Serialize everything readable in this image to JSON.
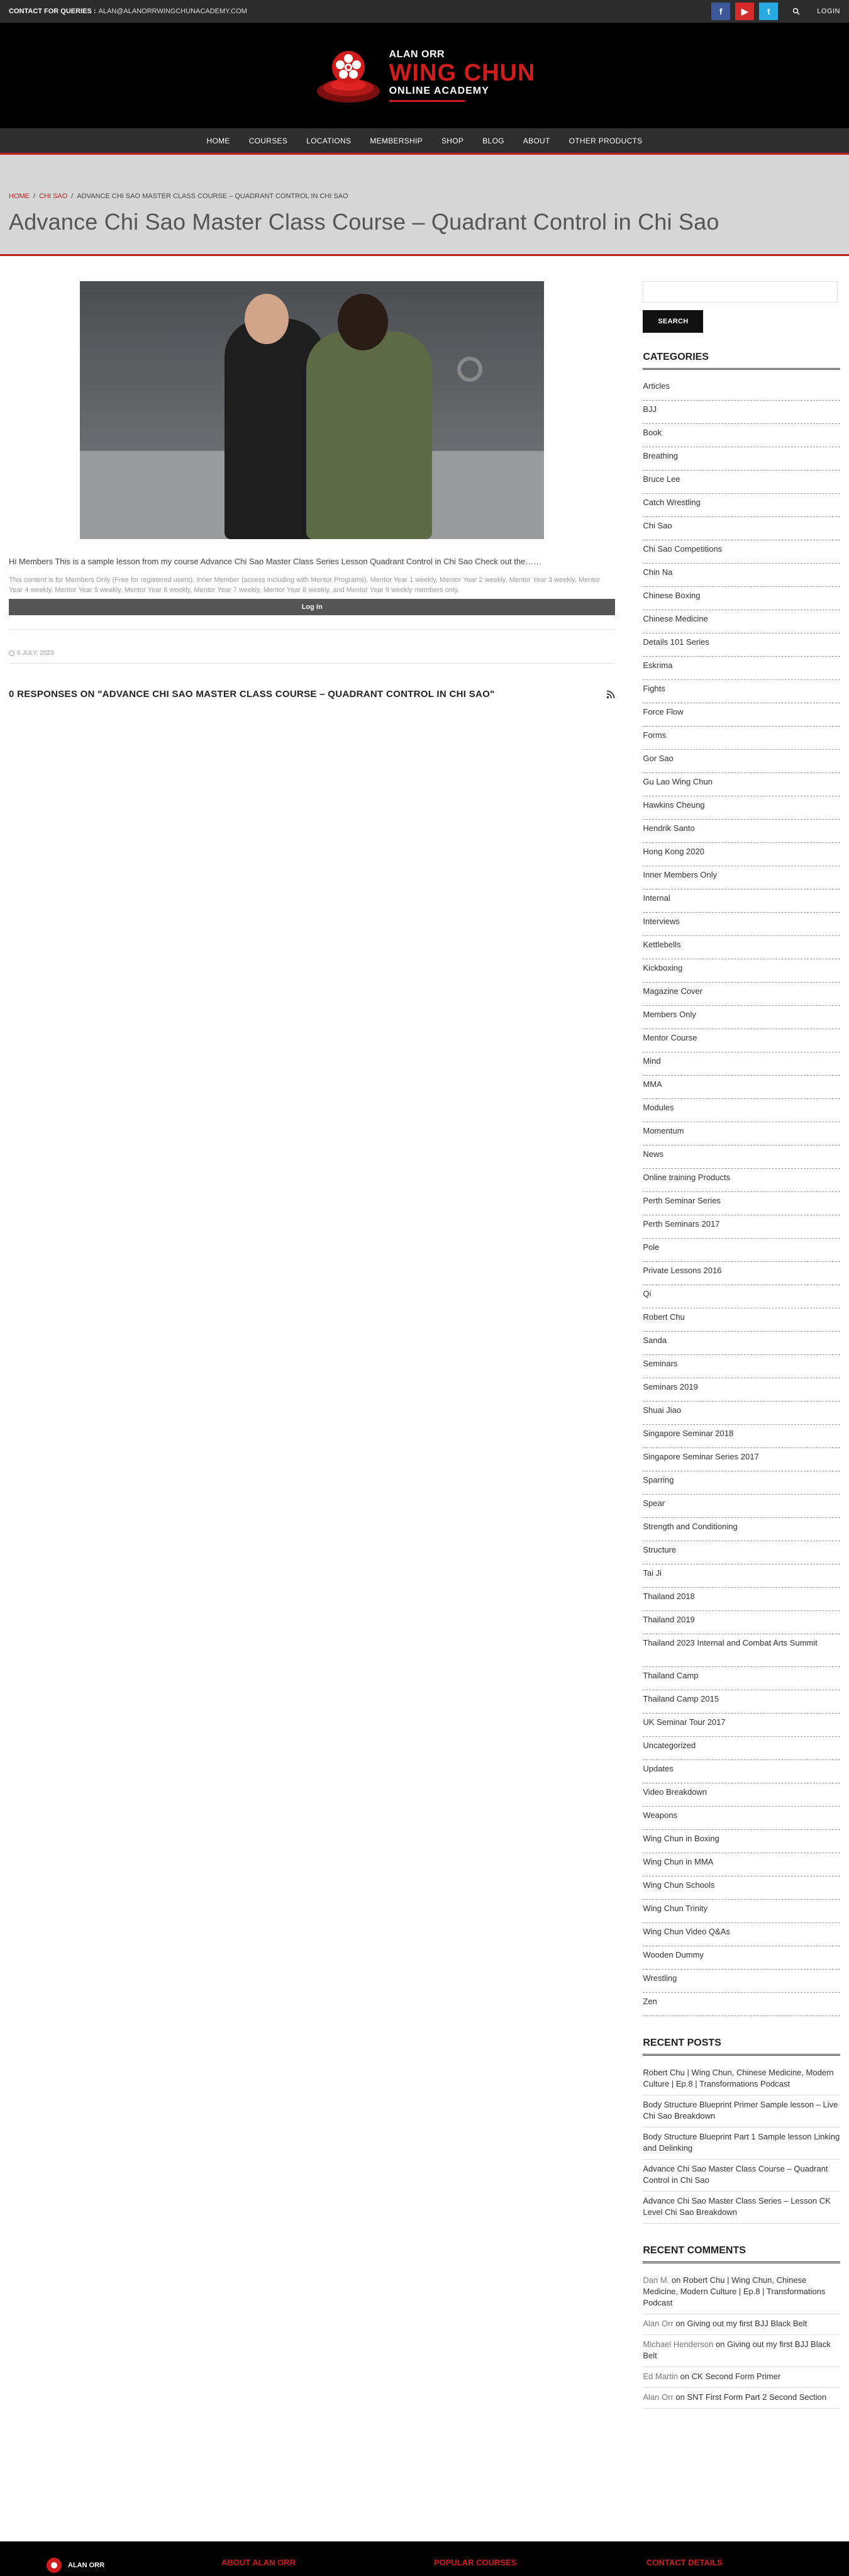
{
  "topbar": {
    "contact_label": "CONTACT FOR QUERIES :",
    "contact_email": "ALAN@ALANORRWINGCHUNACADEMY.COM",
    "facebook": "f",
    "youtube": "▶",
    "twitter": "t",
    "login": "LOGIN"
  },
  "logo": {
    "top": "ALAN ORR",
    "mid": "WING CHUN",
    "bot": "ONLINE ACADEMY"
  },
  "nav": [
    "HOME",
    "COURSES",
    "LOCATIONS",
    "MEMBERSHIP",
    "SHOP",
    "BLOG",
    "ABOUT",
    "OTHER PRODUCTS"
  ],
  "breadcrumb": {
    "home": "HOME",
    "sep1": "/",
    "chi_sao": "CHI SAO",
    "sep2": "/",
    "current": "ADVANCE CHI SAO MASTER CLASS COURSE – QUADRANT CONTROL IN CHI SAO"
  },
  "page_title": "Advance Chi Sao Master Class Course – Quadrant Control in Chi Sao",
  "post": {
    "excerpt": "Hi Members This is a sample lesson from my course Advance Chi Sao Master Class Series Lesson Quadrant Control in Chi Sao Check out the……",
    "members_note": "This content is for Members Only (Free for registered users), Inner Member (access including with Mentor Programs), Mentor Year 1 weekly, Mentor Year 2 weekly, Mentor Year 3 weekly, Mentor Year 4 weekly, Mentor Year 5 weekly, Mentor Year 6 weekly, Mentor Year 7 weekly, Mentor Year 8 weekly, and Mentor Year 9 weekly members only.",
    "login_button": "Log In",
    "date": "6 JULY, 2023",
    "responses": "0 RESPONSES ON \"ADVANCE CHI SAO MASTER CLASS COURSE – QUADRANT CONTROL IN CHI SAO\""
  },
  "sidebar": {
    "search_button": "SEARCH",
    "categories_title": "CATEGORIES",
    "categories": [
      "Articles",
      "BJJ",
      "Book",
      "Breathing",
      "Bruce Lee",
      "Catch Wrestling",
      "Chi Sao",
      "Chi Sao Competitions",
      "Chin Na",
      "Chinese Boxing",
      "Chinese Medicine",
      "Details 101 Series",
      "Eskrima",
      "Fights",
      "Force Flow",
      "Forms",
      "Gor Sao",
      "Gu Lao Wing Chun",
      "Hawkins Cheung",
      "Hendrik Santo",
      "Hong Kong 2020",
      "Inner Members Only",
      "Internal",
      "Interviews",
      "Kettlebells",
      "Kickboxing",
      "Magazine Cover",
      "Members Only",
      "Mentor Course",
      "Mind",
      "MMA",
      "Modules",
      "Momentum",
      "News",
      "Online training Products",
      "Perth Seminar Series",
      "Perth Seminars 2017",
      "Pole",
      "Private Lessons 2016",
      "Qi",
      "Robert Chu",
      "Sanda",
      "Seminars",
      "Seminars 2019",
      "Shuai Jiao",
      "Singapore Seminar 2018",
      "Singapore Seminar Series 2017",
      "Sparring",
      "Spear",
      "Strength and Conditioning",
      "Structure",
      "Tai Ji",
      "Thailand 2018",
      "Thailand 2019",
      "Thailand 2023 Internal and Combat Arts Summit",
      "Thailand Camp",
      "Thailand Camp 2015",
      "UK Seminar Tour 2017",
      "Uncategorized",
      "Updates",
      "Video Breakdown",
      "Weapons",
      "Wing Chun in Boxing",
      "Wing Chun in MMA",
      "Wing Chun Schools",
      "Wing Chun Trinity",
      "Wing Chun Video Q&As",
      "Wooden Dummy",
      "Wrestling",
      "Zen"
    ],
    "recent_posts_title": "RECENT POSTS",
    "recent_posts": [
      "Robert Chu | Wing Chun, Chinese Medicine, Modern Culture | Ep.8 | Transformations Podcast",
      "Body Structure Blueprint Primer Sample lesson – Live Chi Sao Breakdown",
      "Body Structure Blueprint Part 1 Sample lesson Linking and Delinking",
      "Advance Chi Sao Master Class Course – Quadrant Control in Chi Sao",
      "Advance Chi Sao Master Class Series – Lesson CK Level Chi Sao Breakdown"
    ],
    "recent_comments_title": "RECENT COMMENTS",
    "recent_comments": [
      {
        "author": "Dan M.",
        "on": "on",
        "post": "Robert Chu | Wing Chun, Chinese Medicine, Modern Culture | Ep.8 | Transformations Podcast"
      },
      {
        "author": "Alan Orr",
        "on": "on",
        "post": "Giving out my first BJJ Black Belt"
      },
      {
        "author": "Michael Henderson",
        "on": "on",
        "post": "Giving out my first BJJ Black Belt"
      },
      {
        "author": "Ed Martin",
        "on": "on",
        "post": "CK Second Form Primer"
      },
      {
        "author": "Alan Orr",
        "on": "on",
        "post": "SNT First Form Part 2 Second Section"
      }
    ]
  },
  "footer": {
    "logo_text": "ALAN ORR",
    "about": "ABOUT ALAN ORR",
    "popular": "POPULAR COURSES",
    "contact": "CONTACT DETAILS"
  }
}
